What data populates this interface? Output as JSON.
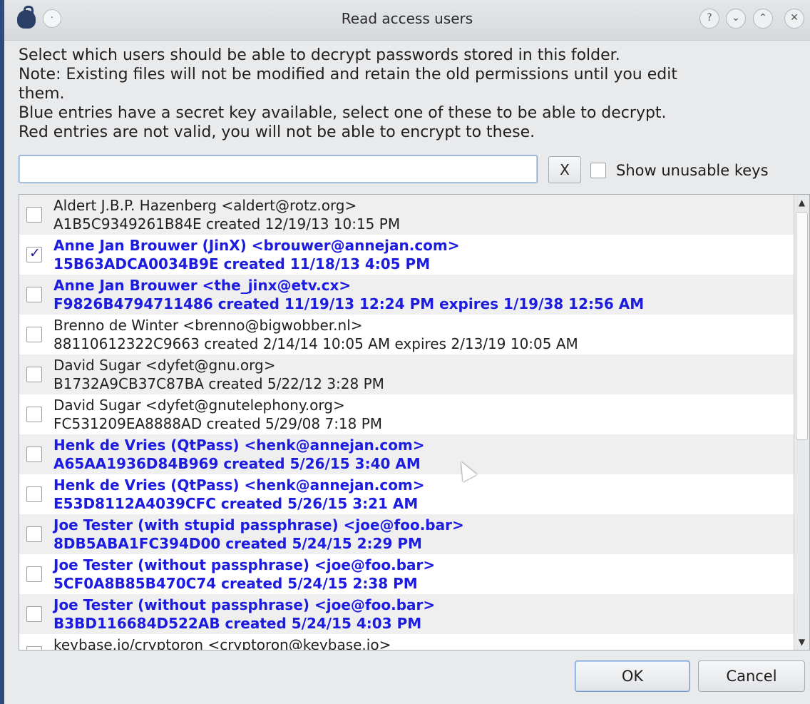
{
  "window": {
    "title": "Read access users",
    "menu_glyph": "·",
    "controls": {
      "help": "?",
      "minimize": "⌄",
      "maximize": "⌃",
      "close": "✕"
    }
  },
  "description": [
    "Select which users should be able to decrypt passwords stored in this folder.",
    "Note: Existing files will not be modified and retain the old permissions until you edit",
    "them.",
    "Blue entries have a secret key available, select one of these to be able to decrypt.",
    "Red entries are not valid, you will not be able to encrypt to these."
  ],
  "search": {
    "value": "",
    "placeholder": ""
  },
  "clear_button": "X",
  "show_unusable": {
    "label": "Show unusable keys",
    "checked": false
  },
  "users": [
    {
      "line1": "Aldert J.B.P. Hazenberg <aldert@rotz.org>",
      "line2": "A1B5C9349261B84E created 12/19/13 10:15 PM",
      "secret": false,
      "checked": false
    },
    {
      "line1": "Anne Jan Brouwer (JinX) <brouwer@annejan.com>",
      "line2": "15B63ADCA0034B9E created 11/18/13 4:05 PM",
      "secret": true,
      "checked": true
    },
    {
      "line1": "Anne Jan Brouwer <the_jinx@etv.cx>",
      "line2": "F9826B4794711486 created 11/19/13 12:24 PM expires 1/19/38 12:56 AM",
      "secret": true,
      "checked": false
    },
    {
      "line1": "Brenno de Winter <brenno@bigwobber.nl>",
      "line2": "88110612322C9663 created 2/14/14 10:05 AM expires 2/13/19 10:05 AM",
      "secret": false,
      "checked": false
    },
    {
      "line1": "David Sugar <dyfet@gnu.org>",
      "line2": "B1732A9CB37C87BA created 5/22/12 3:28 PM",
      "secret": false,
      "checked": false
    },
    {
      "line1": "David Sugar <dyfet@gnutelephony.org>",
      "line2": "FC531209EA8888AD created 5/29/08 7:18 PM",
      "secret": false,
      "checked": false
    },
    {
      "line1": "Henk de Vries (QtPass) <henk@annejan.com>",
      "line2": "A65AA1936D84B969 created 5/26/15 3:40 AM",
      "secret": true,
      "checked": false
    },
    {
      "line1": "Henk de Vries (QtPass) <henk@annejan.com>",
      "line2": "E53D8112A4039CFC created 5/26/15 3:21 AM",
      "secret": true,
      "checked": false
    },
    {
      "line1": "Joe Tester (with stupid passphrase) <joe@foo.bar>",
      "line2": "8DB5ABA1FC394D00 created 5/24/15 2:29 PM",
      "secret": true,
      "checked": false
    },
    {
      "line1": "Joe Tester (without passphrase) <joe@foo.bar>",
      "line2": "5CF0A8B85B470C74 created 5/24/15 2:38 PM",
      "secret": true,
      "checked": false
    },
    {
      "line1": "Joe Tester (without passphrase) <joe@foo.bar>",
      "line2": "B3BD116684D522AB created 5/24/15 4:03 PM",
      "secret": true,
      "checked": false
    },
    {
      "line1": "keybase.io/cryptoron <cryptoron@keybase.io>",
      "line2": "",
      "secret": false,
      "checked": false
    }
  ],
  "buttons": {
    "ok": "OK",
    "cancel": "Cancel"
  },
  "colors": {
    "secret_entry": "#1c1ce0",
    "normal_entry": "#1f1f1f",
    "accent": "#6f9ad1"
  }
}
